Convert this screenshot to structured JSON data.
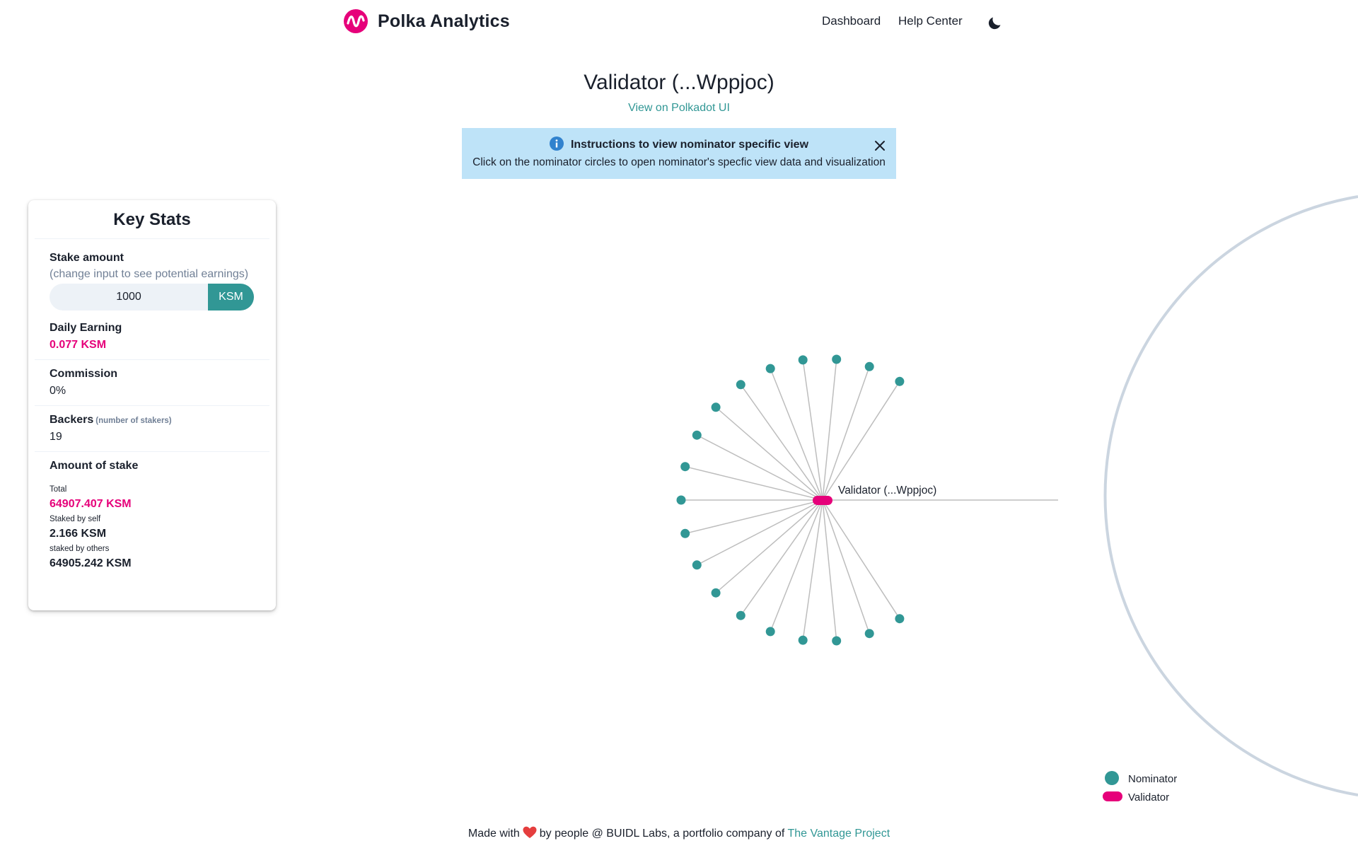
{
  "brand": {
    "name": "Polka Analytics",
    "logo_icon": "polka-wave-logo",
    "logo_color": "#E6007A"
  },
  "nav": {
    "items": [
      "Dashboard",
      "Help Center"
    ],
    "theme_icon": "moon-icon"
  },
  "page": {
    "title": "Validator (...Wppjoc)",
    "link": "View on Polkadot UI"
  },
  "alert": {
    "icon": "info-icon",
    "title": "Instructions to view nominator specific view",
    "body": "Click on the nominator circles to open nominator's specfic view data and visualization"
  },
  "key_stats": {
    "title": "Key Stats",
    "stake_amount_label": "Stake amount",
    "stake_amount_hint": "(change input to see potential earnings)",
    "stake_input_value": "1000",
    "stake_unit": "KSM",
    "daily_earning_label": "Daily Earning",
    "daily_earning_value": "0.077 KSM",
    "commission_label": "Commission",
    "commission_value": "0%",
    "backers_label": "Backers",
    "backers_hint": "(number of stakers)",
    "backers_value": "19",
    "amount_of_stake_label": "Amount of stake",
    "total_label": "Total",
    "total_value": "64907.407 KSM",
    "self_label": "Staked by self",
    "self_value": "2.166 KSM",
    "others_label": "staked by others",
    "others_value": "64905.242 KSM"
  },
  "graph": {
    "validator_label": "Validator (...Wppjoc)",
    "nominator_count": 19,
    "colors": {
      "nominator": "#319795",
      "validator": "#E6007A",
      "edge": "#BDBDBD",
      "orbit": "#CBD5E0"
    }
  },
  "legend": {
    "nominator": "Nominator",
    "validator": "Validator"
  },
  "footer": {
    "prefix": "Made with",
    "heart_icon": "heart-icon",
    "middle": "by people @ BUIDL Labs, a portfolio company of",
    "link": "The Vantage Project"
  }
}
